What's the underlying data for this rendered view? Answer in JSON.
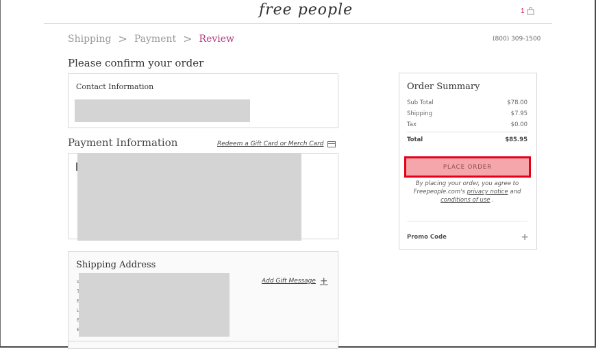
{
  "header": {
    "logo_text": "free people",
    "cart_count": "1"
  },
  "breadcrumb": {
    "step1": "Shipping",
    "step2": "Payment",
    "step3": "Review",
    "separator": ">"
  },
  "phone": "(800) 309-1500",
  "page_title": "Please confirm your order",
  "contact": {
    "title": "Contact Information"
  },
  "payment": {
    "title": "Payment Information",
    "redeem_link": "Redeem a Gift Card or Merch Card"
  },
  "shipping": {
    "title": "Shipping Address",
    "gift_link": "Add Gift Message",
    "partial_letters": [
      "s",
      "T",
      "E",
      "L",
      "6",
      "E"
    ]
  },
  "summary": {
    "title": "Order Summary",
    "subtotal_label": "Sub Total",
    "subtotal_value": "$78.00",
    "shipping_label": "Shipping",
    "shipping_value": "$7.95",
    "tax_label": "Tax",
    "tax_value": "$0.00",
    "total_label": "Total",
    "total_value": "$85.95",
    "place_order": "PLACE ORDER",
    "agree_pre": "By placing your order, you agree to Freepeople.com's",
    "privacy_link": "privacy notice",
    "agree_and": "and",
    "terms_link": "conditions of use",
    "agree_post": ".",
    "promo_label": "Promo Code"
  },
  "colors": {
    "accent": "#b2397e",
    "place_order_bg": "#f4a6ab",
    "highlight_border": "#e5001a",
    "redaction": "#d4d4d4"
  }
}
